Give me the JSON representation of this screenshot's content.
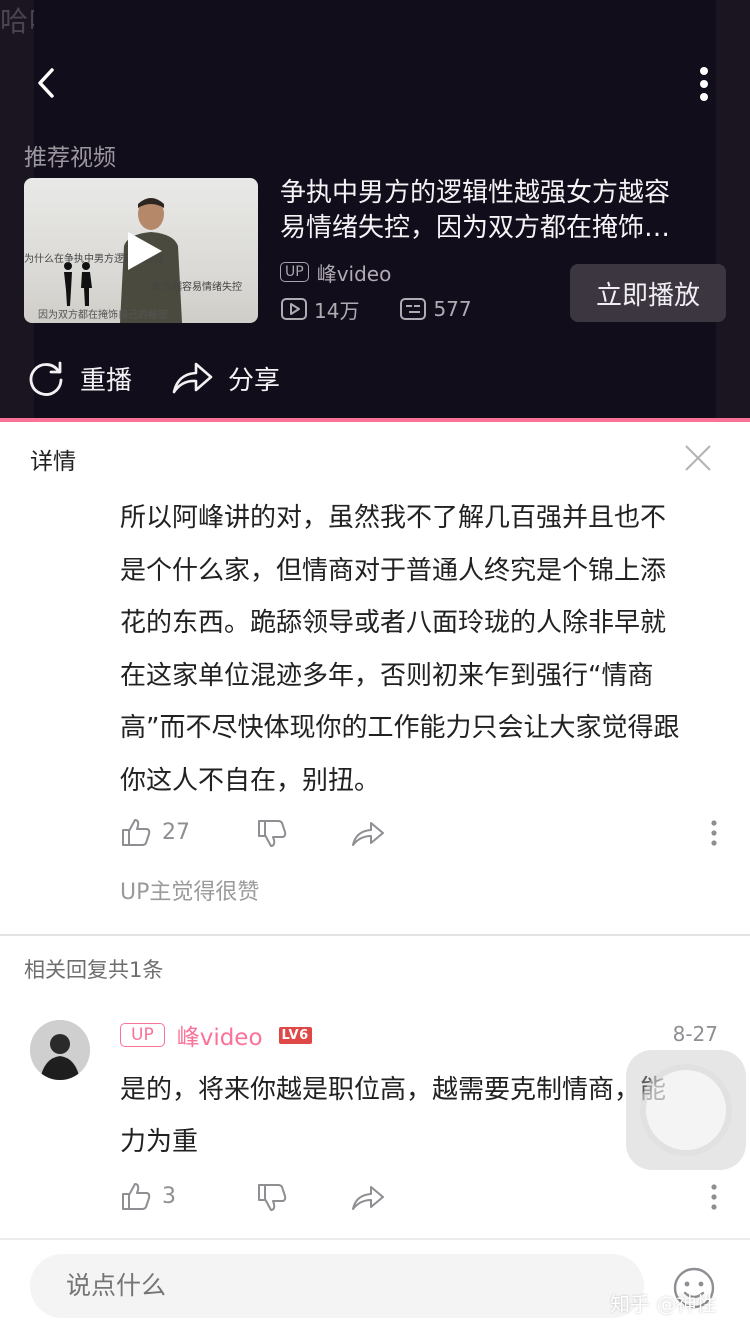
{
  "player": {
    "ghost_text": "哈哈哈哈",
    "recommended_label": "推荐视频",
    "thumbnail_lines": [
      "为什么在争执中男方逻辑性越强",
      "女方越容易情绪失控",
      "因为双方都在掩饰自己的秘密"
    ],
    "video_title_lines": [
      "争执中男方的逻辑性越强女方越容",
      "易情绪失控，因为双方都在掩饰…"
    ],
    "up_badge": "UP",
    "up_name": "峰video",
    "views": "14万",
    "comments": "577",
    "play_now_label": "立即播放",
    "replay_label": "重播",
    "share_label": "分享"
  },
  "detail": {
    "title": "详情",
    "comment_lines": [
      "所以阿峰讲的对，虽然我不了解几百强并且也不",
      "是个什么家，但情商对于普通人终究是个锦上添",
      "花的东西。跪舔领导或者八面玲珑的人除非早就",
      "在这家单位混迹多年，否则初来乍到强行“情商",
      "高”而不尽快体现你的工作能力只会让大家觉得跟",
      "你这人不自在，别扭。"
    ],
    "likes": "27",
    "up_liked": "UP主觉得很赞",
    "related_replies": "相关回复共1条"
  },
  "reply": {
    "badge": "UP",
    "name": "峰video",
    "level": "LV6",
    "date": "8-27",
    "body_lines": [
      "是的，将来你越是职位高，越需要克制情商，能",
      "力为重"
    ],
    "likes": "3"
  },
  "input": {
    "placeholder": "说点什么"
  },
  "watermark": "知乎 @神性",
  "colors": {
    "accent": "#fb7299",
    "player_bg": "#1b1522",
    "level_badge": "#e04848"
  }
}
